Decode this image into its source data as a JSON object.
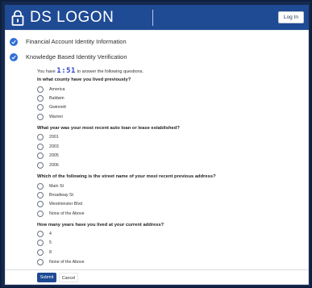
{
  "header": {
    "brand": "DS LOGON",
    "login_label": "Log In",
    "colors": {
      "bar": "#1f4a94",
      "page": "#16294f"
    }
  },
  "steps": [
    {
      "label": "Financial Account Identity Information",
      "icon": "check-icon"
    },
    {
      "label": "Knowledge Based Identity Verification",
      "icon": "check-icon"
    }
  ],
  "timer": {
    "prefix": "You have",
    "time": "1:51",
    "suffix": "to answer the following questions."
  },
  "questions": [
    {
      "text": "In what county have you lived previously?",
      "options": [
        "America",
        "Baldwin",
        "Gwinnett",
        "Warren"
      ]
    },
    {
      "text": "What year was your most recent auto loan or lease established?",
      "options": [
        "2001",
        "2003",
        "2005",
        "2006"
      ]
    },
    {
      "text": "Which of the following is the street name of your most recent previous address?",
      "options": [
        "Main St",
        "Broadway St",
        "Westminster Blvd",
        "None of the Above"
      ]
    },
    {
      "text": "How many years have you lived at your current address?",
      "options": [
        "4",
        "5",
        "8",
        "None of the Above"
      ]
    }
  ],
  "actions": {
    "submit_label": "Submit",
    "cancel_label": "Cancel"
  }
}
